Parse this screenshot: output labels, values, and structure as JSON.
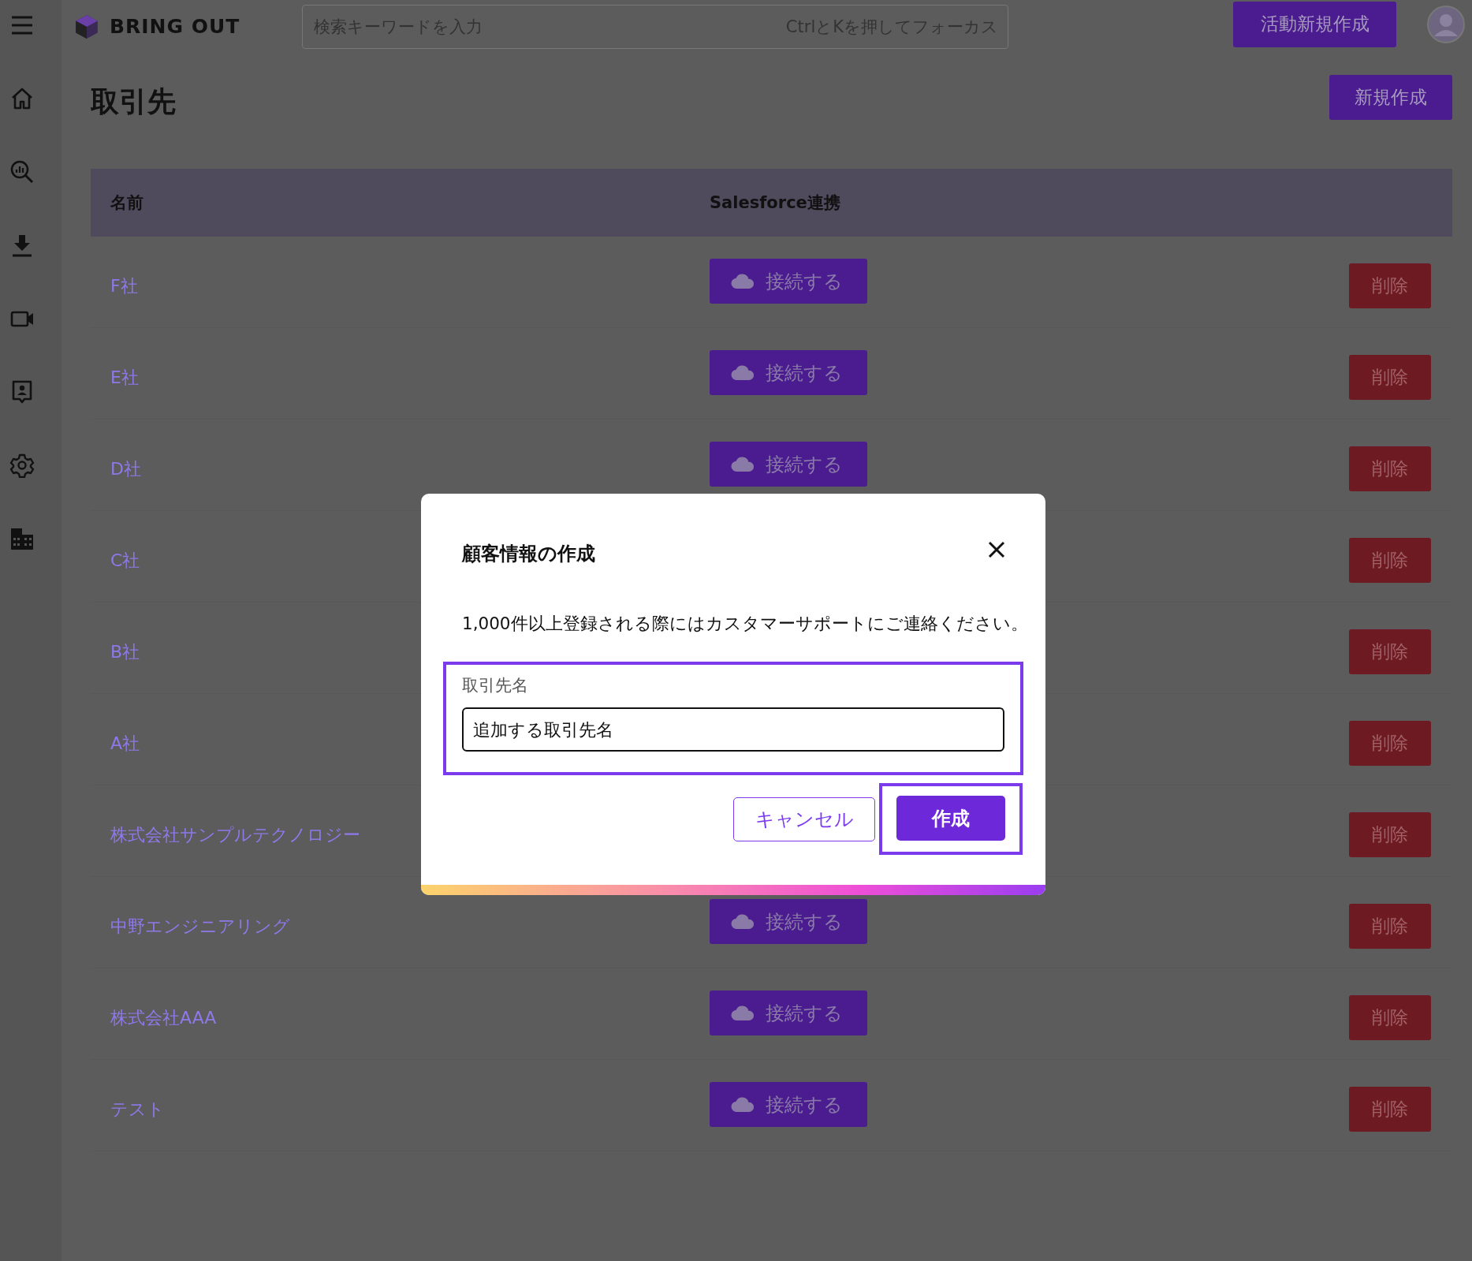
{
  "header": {
    "logo": "BRING OUT",
    "search": {
      "placeholder": "検索キーワードを入力",
      "shortcut_hint": "CtrlとKを押してフォーカス"
    },
    "new_activity_button": "活動新規作成"
  },
  "page": {
    "title": "取引先",
    "new_button": "新規作成"
  },
  "table": {
    "columns": [
      "名前",
      "Salesforce連携"
    ],
    "rows": [
      {
        "name": "F社",
        "connect": "接続する",
        "delete": "削除"
      },
      {
        "name": "E社",
        "connect": "接続する",
        "delete": "削除"
      },
      {
        "name": "D社",
        "connect": "接続する",
        "delete": "削除"
      },
      {
        "name": "C社",
        "delete": "削除"
      },
      {
        "name": "B社",
        "delete": "削除"
      },
      {
        "name": "A社",
        "delete": "削除"
      },
      {
        "name": "株式会社サンプルテクノロジー",
        "delete": "削除"
      },
      {
        "name": "中野エンジニアリング",
        "connect": "接続する",
        "delete": "削除"
      },
      {
        "name": "株式会社AAA",
        "connect": "接続する",
        "delete": "削除"
      },
      {
        "name": "テスト",
        "connect": "接続する",
        "delete": "削除"
      }
    ]
  },
  "dialog": {
    "title": "顧客情報の作成",
    "message": "1,000件以上登録される際にはカスタマーサポートにご連絡ください。",
    "field": {
      "label": "取引先名",
      "value": "追加する取引先名",
      "highlighted": true
    },
    "cancel_button": "キャンセル",
    "create_button": {
      "label": "作成",
      "highlighted": true
    }
  }
}
